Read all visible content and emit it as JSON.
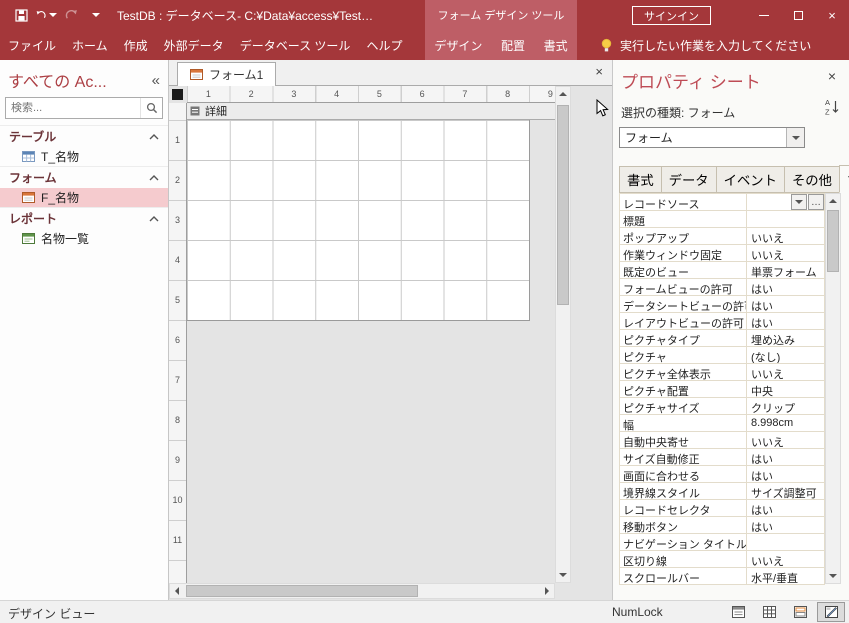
{
  "titlebar": {
    "title": "TestDB : データベース- C:¥Data¥access¥Test…",
    "contextual_title": "フォーム デザイン ツール",
    "signin": "サインイン"
  },
  "ribbon": {
    "tabs": [
      "ファイル",
      "ホーム",
      "作成",
      "外部データ",
      "データベース ツール",
      "ヘルプ"
    ],
    "contextual_tabs": [
      "デザイン",
      "配置",
      "書式"
    ],
    "tell_me": "実行したい作業を入力してください"
  },
  "icons": {
    "collapse_pane": "«",
    "close": "×",
    "builder": "…"
  },
  "nav": {
    "title": "すべての Ac...",
    "search_placeholder": "検索...",
    "groups": [
      {
        "label": "テーブル",
        "items": [
          {
            "label": "T_名物"
          }
        ]
      },
      {
        "label": "フォーム",
        "items": [
          {
            "label": "F_名物"
          }
        ]
      },
      {
        "label": "レポート",
        "items": [
          {
            "label": "名物一覧"
          }
        ]
      }
    ]
  },
  "document": {
    "tab_label": "フォーム1",
    "section_label": "詳細",
    "h_ruler": [
      "1",
      "2",
      "3",
      "4",
      "5",
      "6",
      "7",
      "8",
      "9"
    ],
    "v_ruler": [
      "1",
      "2",
      "3",
      "4",
      "5",
      "6",
      "7",
      "8",
      "9",
      "10",
      "11"
    ]
  },
  "properties": {
    "title": "プロパティ シート",
    "selection_type": "選択の種類: フォーム",
    "selector_value": "フォーム",
    "tabs": [
      "書式",
      "データ",
      "イベント",
      "その他",
      "すべて"
    ],
    "active_tab": "すべて",
    "rows": [
      {
        "name": "レコードソース",
        "value": ""
      },
      {
        "name": "標題",
        "value": ""
      },
      {
        "name": "ポップアップ",
        "value": "いいえ"
      },
      {
        "name": "作業ウィンドウ固定",
        "value": "いいえ"
      },
      {
        "name": "既定のビュー",
        "value": "単票フォーム"
      },
      {
        "name": "フォームビューの許可",
        "value": "はい"
      },
      {
        "name": "データシートビューの許可",
        "value": "はい"
      },
      {
        "name": "レイアウトビューの許可",
        "value": "はい"
      },
      {
        "name": "ピクチャタイプ",
        "value": "埋め込み"
      },
      {
        "name": "ピクチャ",
        "value": "(なし)"
      },
      {
        "name": "ピクチャ全体表示",
        "value": "いいえ"
      },
      {
        "name": "ピクチャ配置",
        "value": "中央"
      },
      {
        "name": "ピクチャサイズ",
        "value": "クリップ"
      },
      {
        "name": "幅",
        "value": "8.998cm"
      },
      {
        "name": "自動中央寄せ",
        "value": "いいえ"
      },
      {
        "name": "サイズ自動修正",
        "value": "はい"
      },
      {
        "name": "画面に合わせる",
        "value": "はい"
      },
      {
        "name": "境界線スタイル",
        "value": "サイズ調整可"
      },
      {
        "name": "レコードセレクタ",
        "value": "はい"
      },
      {
        "name": "移動ボタン",
        "value": "はい"
      },
      {
        "name": "ナビゲーション タイトル",
        "value": ""
      },
      {
        "name": "区切り線",
        "value": "いいえ"
      },
      {
        "name": "スクロールバー",
        "value": "水平/垂直"
      }
    ]
  },
  "statusbar": {
    "view_label": "デザイン ビュー",
    "numlock": "NumLock"
  },
  "colors": {
    "ribbon_red": "#A4373A",
    "contextual_red": "#BE5E66",
    "selected_pink": "#F5CBCE",
    "title_red": "#BE4B55"
  }
}
